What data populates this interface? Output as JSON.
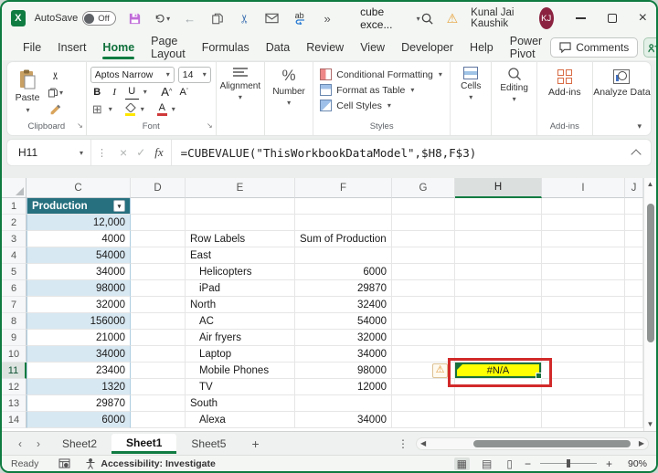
{
  "window": {
    "autosave_label": "AutoSave",
    "autosave_state": "Off",
    "title": "cube exce...",
    "qat_replace_text": "ab",
    "user_name": "Kunal Jai Kaushik",
    "user_initials": "KJ"
  },
  "menu": {
    "items": [
      "File",
      "Insert",
      "Home",
      "Page Layout",
      "Formulas",
      "Data",
      "Review",
      "View",
      "Developer",
      "Help",
      "Power Pivot"
    ],
    "active": "Home",
    "comments_label": "Comments"
  },
  "ribbon": {
    "clipboard": {
      "paste": "Paste",
      "group": "Clipboard"
    },
    "font": {
      "name": "Aptos Narrow",
      "size": "14",
      "bold": "B",
      "italic": "I",
      "underline": "U",
      "grow": "A",
      "shrink": "A",
      "color_letter": "A",
      "group": "Font"
    },
    "alignment": {
      "label": "Alignment"
    },
    "number": {
      "label": "Number",
      "symbol": "%"
    },
    "styles": {
      "cf": "Conditional Formatting",
      "fat": "Format as Table",
      "cs": "Cell Styles",
      "group": "Styles"
    },
    "cells": {
      "label": "Cells"
    },
    "editing": {
      "label": "Editing"
    },
    "addins": {
      "label": "Add-ins",
      "group": "Add-ins"
    },
    "analyze": {
      "label": "Analyze Data"
    }
  },
  "formula_bar": {
    "name_box": "H11",
    "fx": "fx",
    "formula": "=CUBEVALUE(\"ThisWorkbookDataModel\",$H8,F$3)"
  },
  "grid": {
    "col_headers": [
      "C",
      "D",
      "E",
      "F",
      "G",
      "H",
      "I",
      "J"
    ],
    "selected_cell": "H11",
    "error_value": "#N/A",
    "rows": [
      {
        "n": "1",
        "C": "Production"
      },
      {
        "n": "2",
        "C": "12,000"
      },
      {
        "n": "3",
        "C": "4000",
        "E": "Row Labels",
        "F": "Sum of Production"
      },
      {
        "n": "4",
        "C": "54000",
        "E": "East"
      },
      {
        "n": "5",
        "C": "34000",
        "E": "Helicopters",
        "F": "6000"
      },
      {
        "n": "6",
        "C": "98000",
        "E": "iPad",
        "F": "29870"
      },
      {
        "n": "7",
        "C": "32000",
        "E": "North",
        "F": "32400"
      },
      {
        "n": "8",
        "C": "156000",
        "E": "AC",
        "F": "54000"
      },
      {
        "n": "9",
        "C": "21000",
        "E": "Air fryers",
        "F": "32000"
      },
      {
        "n": "10",
        "C": "34000",
        "E": "Laptop",
        "F": "34000"
      },
      {
        "n": "11",
        "C": "23400",
        "E": "Mobile Phones",
        "F": "98000"
      },
      {
        "n": "12",
        "C": "1320",
        "E": "TV",
        "F": "12000"
      },
      {
        "n": "13",
        "C": "29870",
        "E": "South"
      },
      {
        "n": "14",
        "C": "6000",
        "E": "Alexa",
        "F": "34000"
      }
    ]
  },
  "tabs": {
    "items": [
      "Sheet2",
      "Sheet1",
      "Sheet5"
    ],
    "active": "Sheet1",
    "new_sheet": "+"
  },
  "status": {
    "ready": "Ready",
    "accessibility": "Accessibility: Investigate",
    "zoom": "90%"
  },
  "colors": {
    "accent_green": "#107c41",
    "table_header_teal": "#26707f",
    "band_blue": "#d8e8f2",
    "error_fill_yellow": "#ffff00",
    "annotation_red": "#d22a2a",
    "avatar_maroon": "#8b2340",
    "addins_orange": "#d86b44"
  }
}
